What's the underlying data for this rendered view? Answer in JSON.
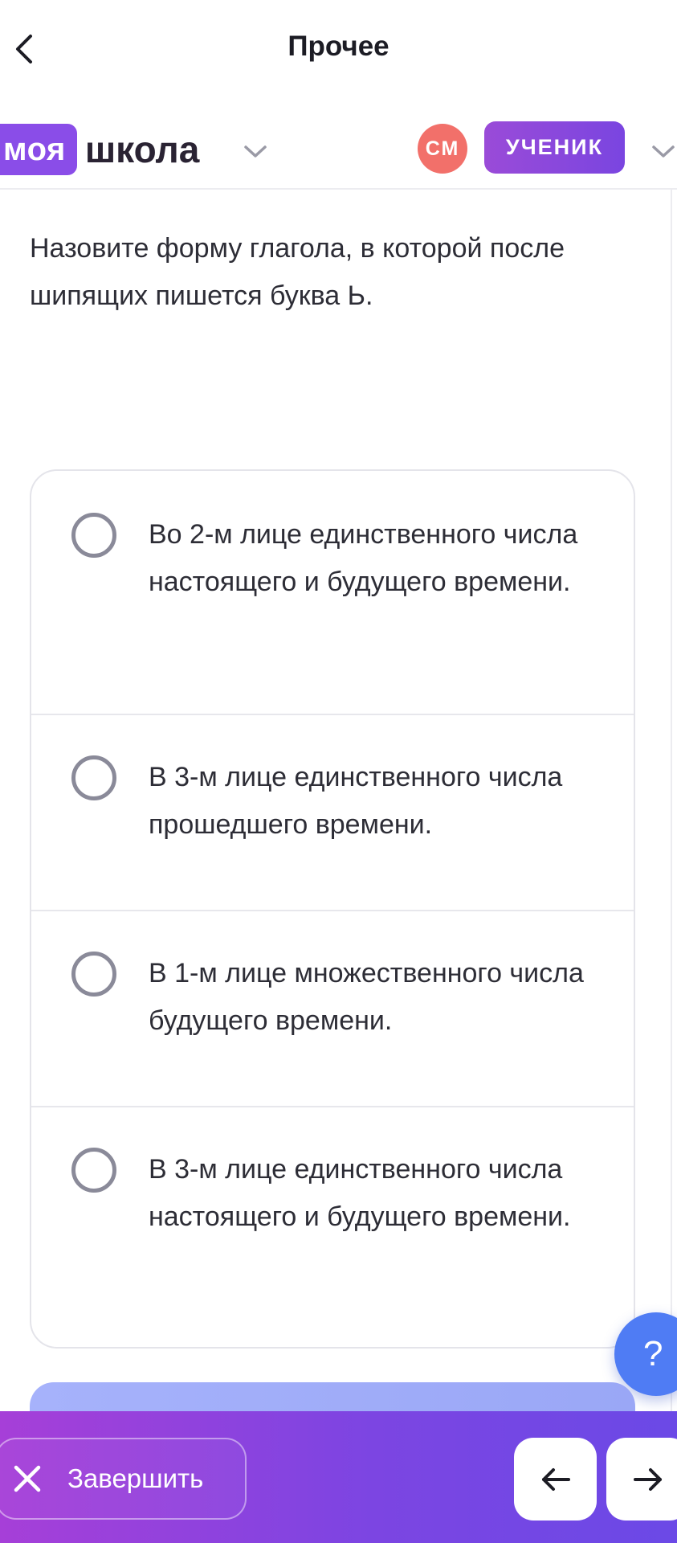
{
  "topbar": {
    "title": "Прочее"
  },
  "header": {
    "logo_part1": "моя",
    "logo_part2": "школа",
    "avatar_initials": "СМ",
    "role": "УЧЕНИК"
  },
  "question": {
    "text": "Назовите форму глагола, в которой после шипящих пишется буква Ь."
  },
  "options": [
    {
      "label": "Во 2-м лице единственного числа настоящего и будущего времени."
    },
    {
      "label": "В 3-м лице единственного числа прошедшего времени."
    },
    {
      "label": "В 1-м лице множественного числа будущего времени."
    },
    {
      "label": "В 3-м лице единственного числа настоящего и будущего времени."
    }
  ],
  "help": {
    "label": "?"
  },
  "footer": {
    "finish_label": "Завершить"
  },
  "colors": {
    "brand_purple": "#8a4de8",
    "avatar_red": "#f2706a",
    "help_blue": "#4f7cf4",
    "footer_gradient_start": "#a63fd8",
    "footer_gradient_end": "#6b49e6"
  },
  "icons": {
    "back": "chevron-left-icon",
    "school_dropdown": "chevron-down-icon",
    "role_dropdown": "chevron-down-icon",
    "finish": "close-icon",
    "prev": "arrow-left-icon",
    "next": "arrow-right-icon"
  }
}
